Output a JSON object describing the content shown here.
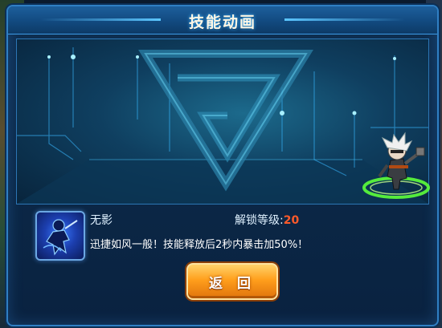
{
  "dialog": {
    "title": "技能动画",
    "skill": {
      "name": "无影",
      "unlock_label": "解锁等级:",
      "unlock_level": "20",
      "description": "迅捷如风一般！技能释放后2秒内暴击加50%！"
    },
    "back_button": "返 回"
  },
  "colors": {
    "frame_border": "#2f7fc4",
    "accent_level": "#ff5a2a",
    "button_orange": "#ff9f1c"
  }
}
